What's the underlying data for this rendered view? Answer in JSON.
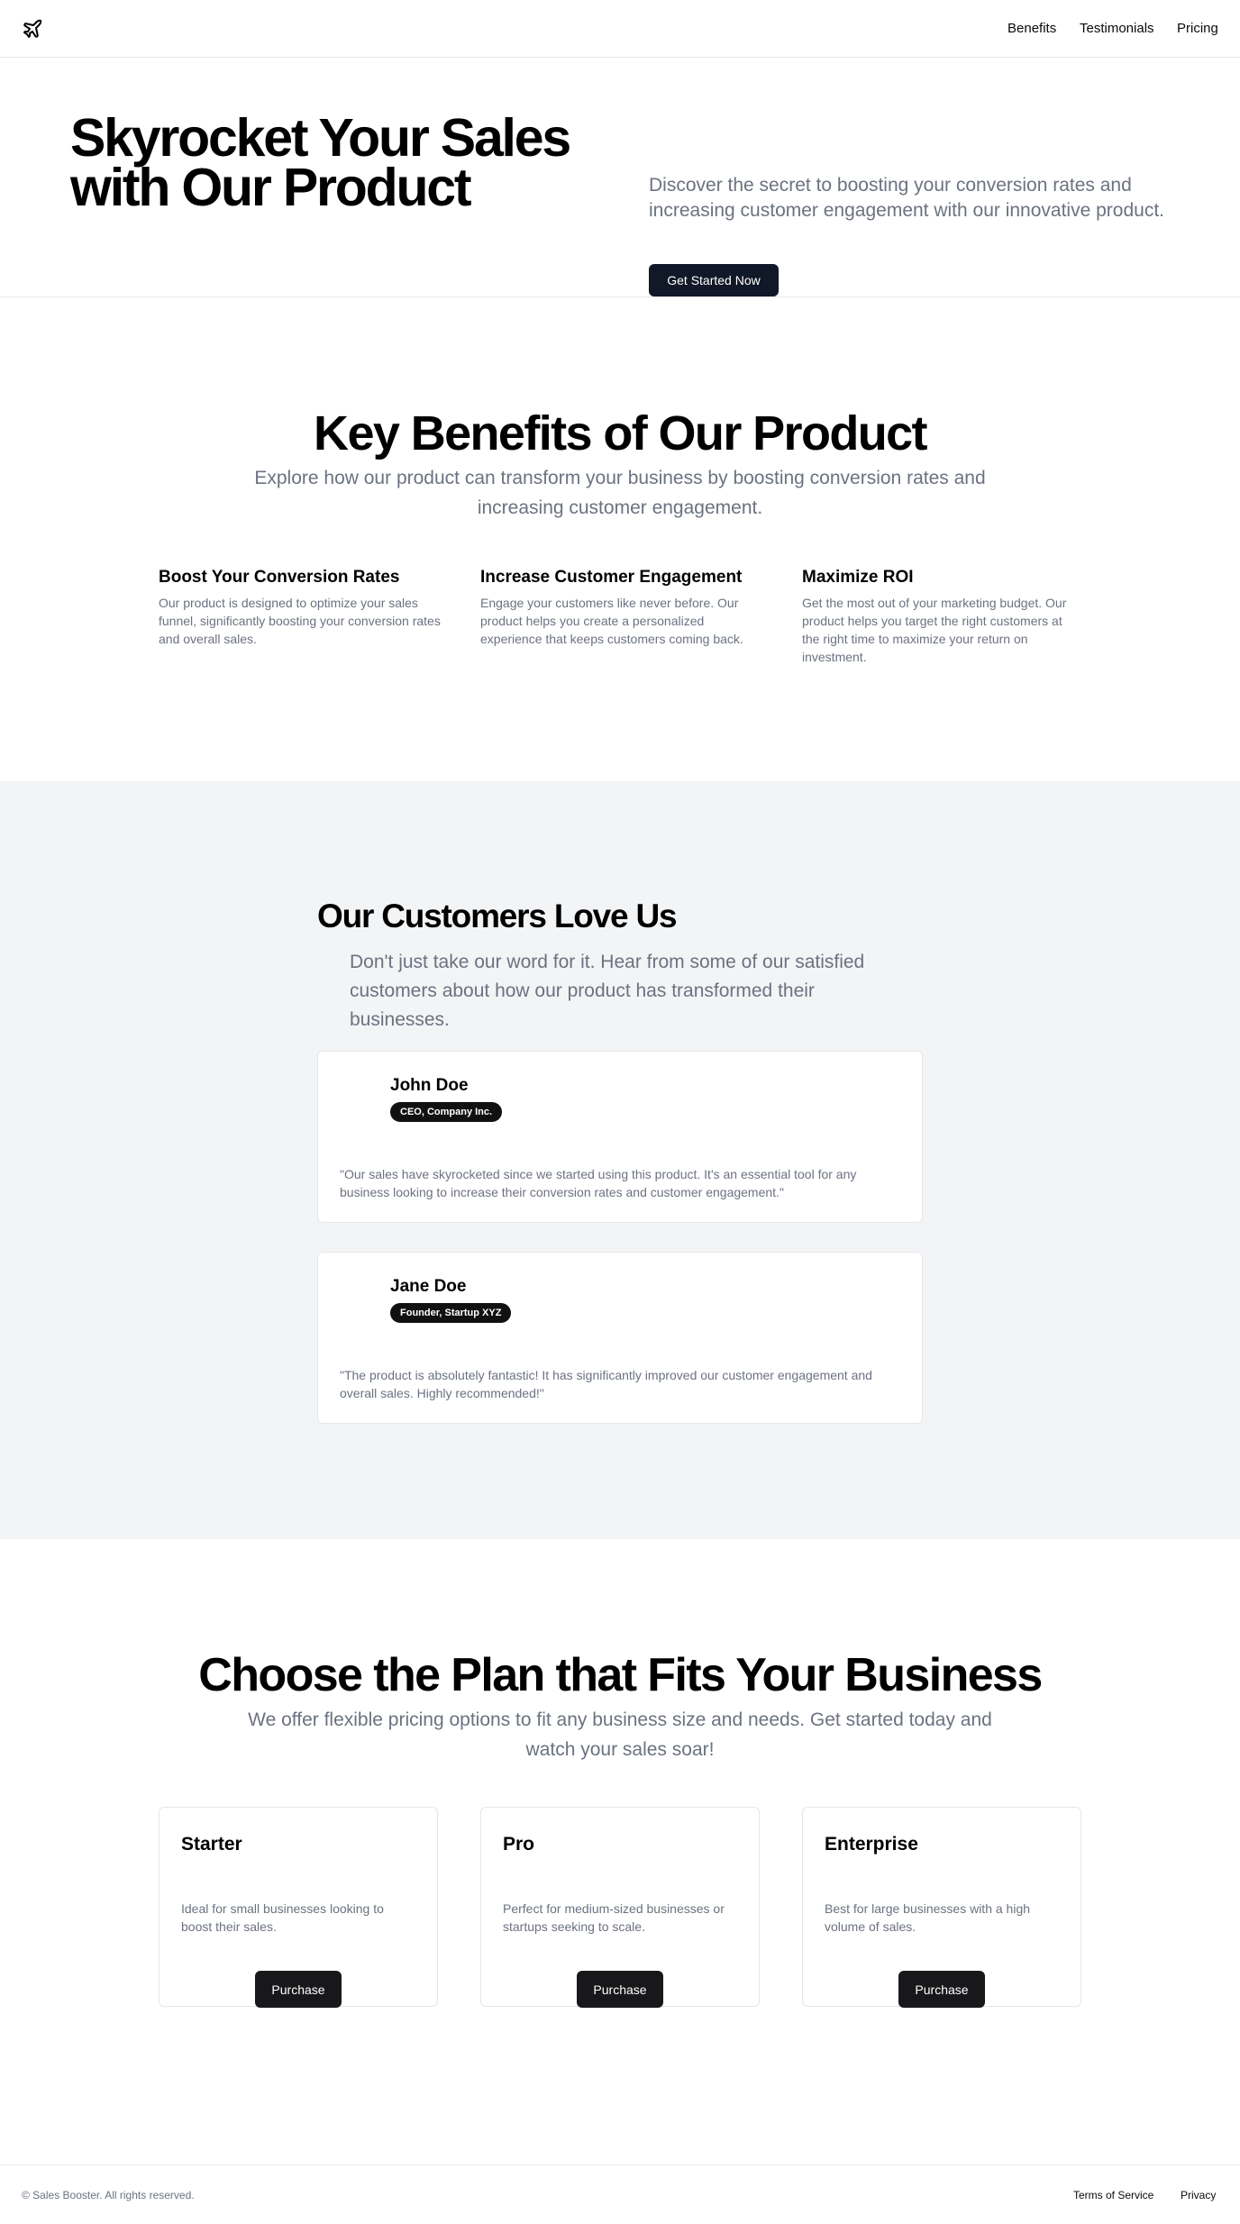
{
  "header": {
    "logo_icon": "airplane-icon",
    "nav": [
      "Benefits",
      "Testimonials",
      "Pricing"
    ]
  },
  "hero": {
    "title": "Skyrocket Your Sales with Our Product",
    "description": "Discover the secret to boosting your conversion rates and increasing customer engagement with our innovative product.",
    "cta": "Get Started Now"
  },
  "benefits": {
    "title": "Key Benefits of Our Product",
    "subtitle": "Explore how our product can transform your business by boosting conversion rates and increasing customer engagement.",
    "items": [
      {
        "title": "Boost Your Conversion Rates",
        "desc": "Our product is designed to optimize your sales funnel, significantly boosting your conversion rates and overall sales."
      },
      {
        "title": "Increase Customer Engagement",
        "desc": "Engage your customers like never before. Our product helps you create a personalized experience that keeps customers coming back."
      },
      {
        "title": "Maximize ROI",
        "desc": "Get the most out of your marketing budget. Our product helps you target the right customers at the right time to maximize your return on investment."
      }
    ]
  },
  "testimonials": {
    "title": "Our Customers Love Us",
    "subtitle": "Don't just take our word for it. Hear from some of our satisfied customers about how our product has transformed their businesses.",
    "items": [
      {
        "name": "John Doe",
        "role": "CEO, Company Inc.",
        "quote": "\"Our sales have skyrocketed since we started using this product. It's an essential tool for any business looking to increase their conversion rates and customer engagement.\""
      },
      {
        "name": "Jane Doe",
        "role": "Founder, Startup XYZ",
        "quote": "\"The product is absolutely fantastic! It has significantly improved our customer engagement and overall sales. Highly recommended!\""
      }
    ]
  },
  "pricing": {
    "title": "Choose the Plan that Fits Your Business",
    "subtitle": "We offer flexible pricing options to fit any business size and needs. Get started today and watch your sales soar!",
    "plans": [
      {
        "name": "Starter",
        "desc": "Ideal for small businesses looking to boost their sales.",
        "button": "Purchase"
      },
      {
        "name": "Pro",
        "desc": "Perfect for medium-sized businesses or startups seeking to scale.",
        "button": "Purchase"
      },
      {
        "name": "Enterprise",
        "desc": "Best for large businesses with a high volume of sales.",
        "button": "Purchase"
      }
    ]
  },
  "footer": {
    "copyright": "© Sales Booster. All rights reserved.",
    "links": [
      "Terms of Service",
      "Privacy"
    ]
  }
}
